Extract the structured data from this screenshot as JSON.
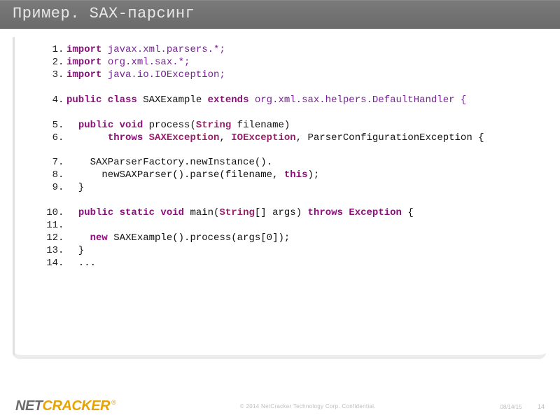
{
  "header": {
    "title": "Пример. SAX-парсинг"
  },
  "code": {
    "lines": [
      {
        "n": "1",
        "kw": "import",
        "rest": " javax.xml.parsers.*;",
        "cls": "pkg"
      },
      {
        "n": "2",
        "kw": "import",
        "rest": " org.xml.sax.*;",
        "cls": "pkg"
      },
      {
        "n": "3",
        "kw": "import",
        "rest": " java.io.IOException;",
        "cls": "pkg"
      }
    ],
    "l4_kw1": "public class",
    "l4_name": " SAXExample ",
    "l4_kw2": "extends",
    "l4_rest": " org.xml.sax.helpers.DefaultHandler {",
    "l5_kw": "public void",
    "l5_name": " process(",
    "l5_type": "String",
    "l5_rest": " filename)",
    "l6_kw": "throws",
    "l6_t1": " SAXException",
    "l6_c1": ", ",
    "l6_t2": "IOException",
    "l6_c2": ", ParserConfigurationException {",
    "l7": "    SAXParserFactory.newInstance().",
    "l8a": "      newSAXParser().parse(filename, ",
    "l8b": "this",
    "l8c": ");",
    "l9": "  }",
    "l10_kw": "public static void",
    "l10a": " main(",
    "l10_type": "String",
    "l10b": "[] args) ",
    "l10_kw2": "throws Exception",
    "l10c": " {",
    "l11": "",
    "l12_kw": "new",
    "l12a": " SAXExample().process(args[0]);",
    "l13": "  }",
    "l14": "  ...",
    "nums": {
      "n4": "4",
      "n5": "5",
      "n6": "6",
      "n7": "7",
      "n8": "8",
      "n9": "9",
      "n10": "10",
      "n11": "11",
      "n12": "12",
      "n13": "13",
      "n14": "14"
    }
  },
  "footer": {
    "logo_net": "NET",
    "logo_cracker": "CRACKER",
    "logo_reg": "®",
    "copyright": "© 2014 NetCracker Technology Corp. Confidential.",
    "date": "08/14/15",
    "page": "14"
  }
}
